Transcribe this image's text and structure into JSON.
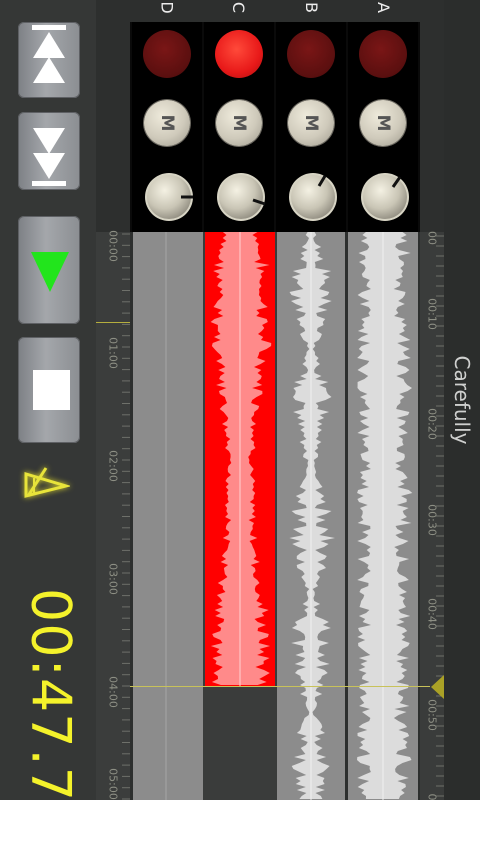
{
  "app": {
    "title": "Carefully",
    "clock": "00:47.7"
  },
  "transport": {
    "buttons": [
      {
        "name": "skip-to-start-button",
        "icon": "skip-to-start-icon"
      },
      {
        "name": "skip-to-end-button",
        "icon": "skip-to-end-icon"
      },
      {
        "name": "play-button",
        "icon": "play-icon"
      },
      {
        "name": "stop-button",
        "icon": "stop-icon"
      },
      {
        "name": "metronome-button",
        "icon": "metronome-icon"
      }
    ]
  },
  "tracks": [
    {
      "label": "D",
      "led_on": false,
      "mute_label": "M",
      "has_audio": false
    },
    {
      "label": "C",
      "led_on": true,
      "mute_label": "M",
      "has_audio": true
    },
    {
      "label": "B",
      "led_on": false,
      "mute_label": "M",
      "has_audio": true
    },
    {
      "label": "A",
      "led_on": false,
      "mute_label": "M",
      "has_audio": true
    }
  ],
  "ruler_left": [
    "00:00",
    "01:00",
    "02:00",
    "03:00",
    "04:00",
    "05:00"
  ],
  "ruler_right": [
    "00",
    "00:10",
    "00:20",
    "00:30",
    "00:40",
    "00:50",
    "0"
  ],
  "colors": {
    "clock": "#f4f22b",
    "play": "#22e51c",
    "led_on": "#e81919",
    "led_off": "#6e1414",
    "track_c": "#ff0000",
    "track_c_wave": "#ff8080",
    "wave": "#d2d2d2"
  }
}
